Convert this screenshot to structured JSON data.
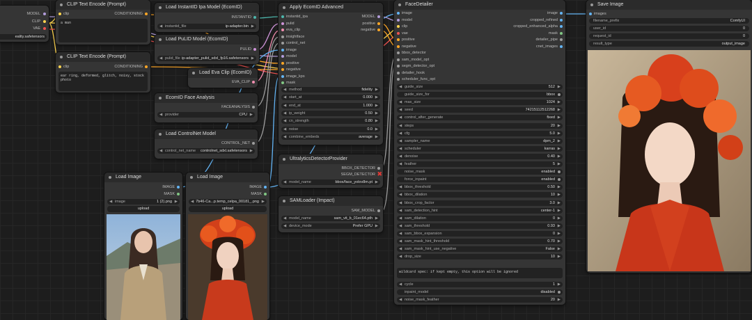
{
  "colors": {
    "model": "#b39ddb",
    "clip": "#ffd54f",
    "vae": "#ef5350",
    "conditioning": "#ffa726",
    "image": "#64b5f6",
    "mask": "#81c784",
    "instantid": "#4db6ac",
    "pulid": "#ce93d8",
    "eva": "#f48fb1",
    "misc": "#9e9e9e"
  },
  "checkpoint": {
    "model": "MODEL",
    "clip": "CLIP",
    "vae": "VAE",
    "ckpt": "eality.safetensors"
  },
  "clip_pos": {
    "title": "CLIP Text Encode (Prompt)",
    "in_clip": "clip",
    "out": "CONDITIONING",
    "text": "a man"
  },
  "clip_neg": {
    "title": "CLIP Text Encode (Prompt)",
    "in_clip": "clip",
    "out": "CONDITIONING",
    "text": "ear ring, deformed, glitch, noisy, stock\nphoto"
  },
  "instantid": {
    "title": "Load InstantID Ipa Model (EcomID)",
    "out": "INSTANTID",
    "w_label": "instantid_file",
    "w_value": "ip-adapter.bin"
  },
  "pulid": {
    "title": "Load PuLID Model (EcomID)",
    "out": "PULID",
    "w_label": "pulid_file",
    "w_value": "ip-adapter_pulid_sdxl_fp16.safetensors"
  },
  "eva": {
    "title": "Load Eva Clip (EcomID)",
    "out": "EVA_CLIP"
  },
  "face_analysis": {
    "title": "EcomID Face Analysis",
    "out": "FACEANALYSIS",
    "w_label": "provider",
    "w_value": "CPU"
  },
  "controlnet": {
    "title": "Load ControlNet Model",
    "out": "CONTROL_NET",
    "w_label": "control_net_name",
    "w_value": "controlnet_sdxl.safetensors"
  },
  "load1": {
    "title": "Load Image",
    "out_image": "IMAGE",
    "out_mask": "MASK",
    "w_label": "image",
    "w_value": "1 (2).png",
    "btn": "upload"
  },
  "load2": {
    "title": "Load Image",
    "out_image": "IMAGE",
    "out_mask": "MASK",
    "w_label": "image",
    "w_value": "7b46-Ca...p.temp_celpa_00181_.png",
    "btn": "upload"
  },
  "apply": {
    "title": "Apply EcomID Advanced",
    "inputs": [
      "instantid_ipa",
      "pulid",
      "eva_clip",
      "insightface",
      "control_net",
      "image",
      "model",
      "positive",
      "negative",
      "image_kps",
      "mask"
    ],
    "outputs": [
      "MODEL",
      "positive",
      "negative"
    ],
    "widgets": [
      {
        "label": "method",
        "value": "fidelity"
      },
      {
        "label": "start_at",
        "value": "0.000"
      },
      {
        "label": "end_at",
        "value": "1.000"
      },
      {
        "label": "ip_weight",
        "value": "0.50"
      },
      {
        "label": "cn_strength",
        "value": "0.80"
      },
      {
        "label": "noise",
        "value": "0.0"
      },
      {
        "label": "combine_embeds",
        "value": "average"
      }
    ]
  },
  "ultra": {
    "title": "UltralyticsDetectorProvider",
    "out1": "BBOX_DETECTOR",
    "out2": "SEGM_DETECTOR",
    "w_label": "model_name",
    "w_value": "bbox/face_yolov8m.pt"
  },
  "sam": {
    "title": "SAMLoader (Impact)",
    "out": "SAM_MODEL",
    "widgets": [
      {
        "label": "model_name",
        "value": "sam_vit_b_01ec64.pth"
      },
      {
        "label": "device_mode",
        "value": "Prefer GPU"
      }
    ]
  },
  "face": {
    "title": "FaceDetailer",
    "inputs": [
      "image",
      "model",
      "clip",
      "vae",
      "positive",
      "negative",
      "bbox_detector",
      "sam_model_opt",
      "segm_detector_opt",
      "detailer_hook",
      "scheduler_func_opt"
    ],
    "outputs": [
      "image",
      "cropped_refined",
      "cropped_enhanced_alpha",
      "mask",
      "detailer_pipe",
      "cnet_images"
    ],
    "widgets": [
      {
        "label": "guide_size",
        "value": "512"
      },
      {
        "label": "guide_size_for",
        "value": "bbox",
        "tog": true
      },
      {
        "label": "max_size",
        "value": "1024"
      },
      {
        "label": "seed",
        "value": "742151125122​68"
      },
      {
        "label": "control_after_generate",
        "value": "fixed"
      },
      {
        "label": "steps",
        "value": "20"
      },
      {
        "label": "cfg",
        "value": "5.0"
      },
      {
        "label": "sampler_name",
        "value": "dpm_2"
      },
      {
        "label": "scheduler",
        "value": "karras"
      },
      {
        "label": "denoise",
        "value": "0.40"
      },
      {
        "label": "feather",
        "value": "5"
      },
      {
        "label": "noise_mask",
        "value": "enabled",
        "tog": true
      },
      {
        "label": "force_inpaint",
        "value": "enabled",
        "tog": true
      },
      {
        "label": "bbox_threshold",
        "value": "0.50"
      },
      {
        "label": "bbox_dilation",
        "value": "10"
      },
      {
        "label": "bbox_crop_factor",
        "value": "3.0"
      },
      {
        "label": "sam_detection_hint",
        "value": "center-1"
      },
      {
        "label": "sam_dilation",
        "value": "0"
      },
      {
        "label": "sam_threshold",
        "value": "0.93"
      },
      {
        "label": "sam_bbox_expansion",
        "value": "0"
      },
      {
        "label": "sam_mask_hint_threshold",
        "value": "0.70"
      },
      {
        "label": "sam_mask_hint_use_negative",
        "value": "False"
      },
      {
        "label": "drop_size",
        "value": "10"
      }
    ],
    "wildcard": "wildcard spec: if kept empty, this option will be ignored",
    "widgets2": [
      {
        "label": "cycle",
        "value": "1"
      },
      {
        "label": "inpaint_model",
        "value": "disabled",
        "tog": true
      },
      {
        "label": "noise_mask_feather",
        "value": "20"
      }
    ]
  },
  "save": {
    "title": "Save Image",
    "in": "images",
    "widgets": [
      {
        "label": "filename_prefix",
        "value": "ComfyUI"
      },
      {
        "label": "user_id",
        "value": "0"
      },
      {
        "label": "request_id",
        "value": "0"
      },
      {
        "label": "result_type",
        "value": "output_image"
      }
    ]
  }
}
